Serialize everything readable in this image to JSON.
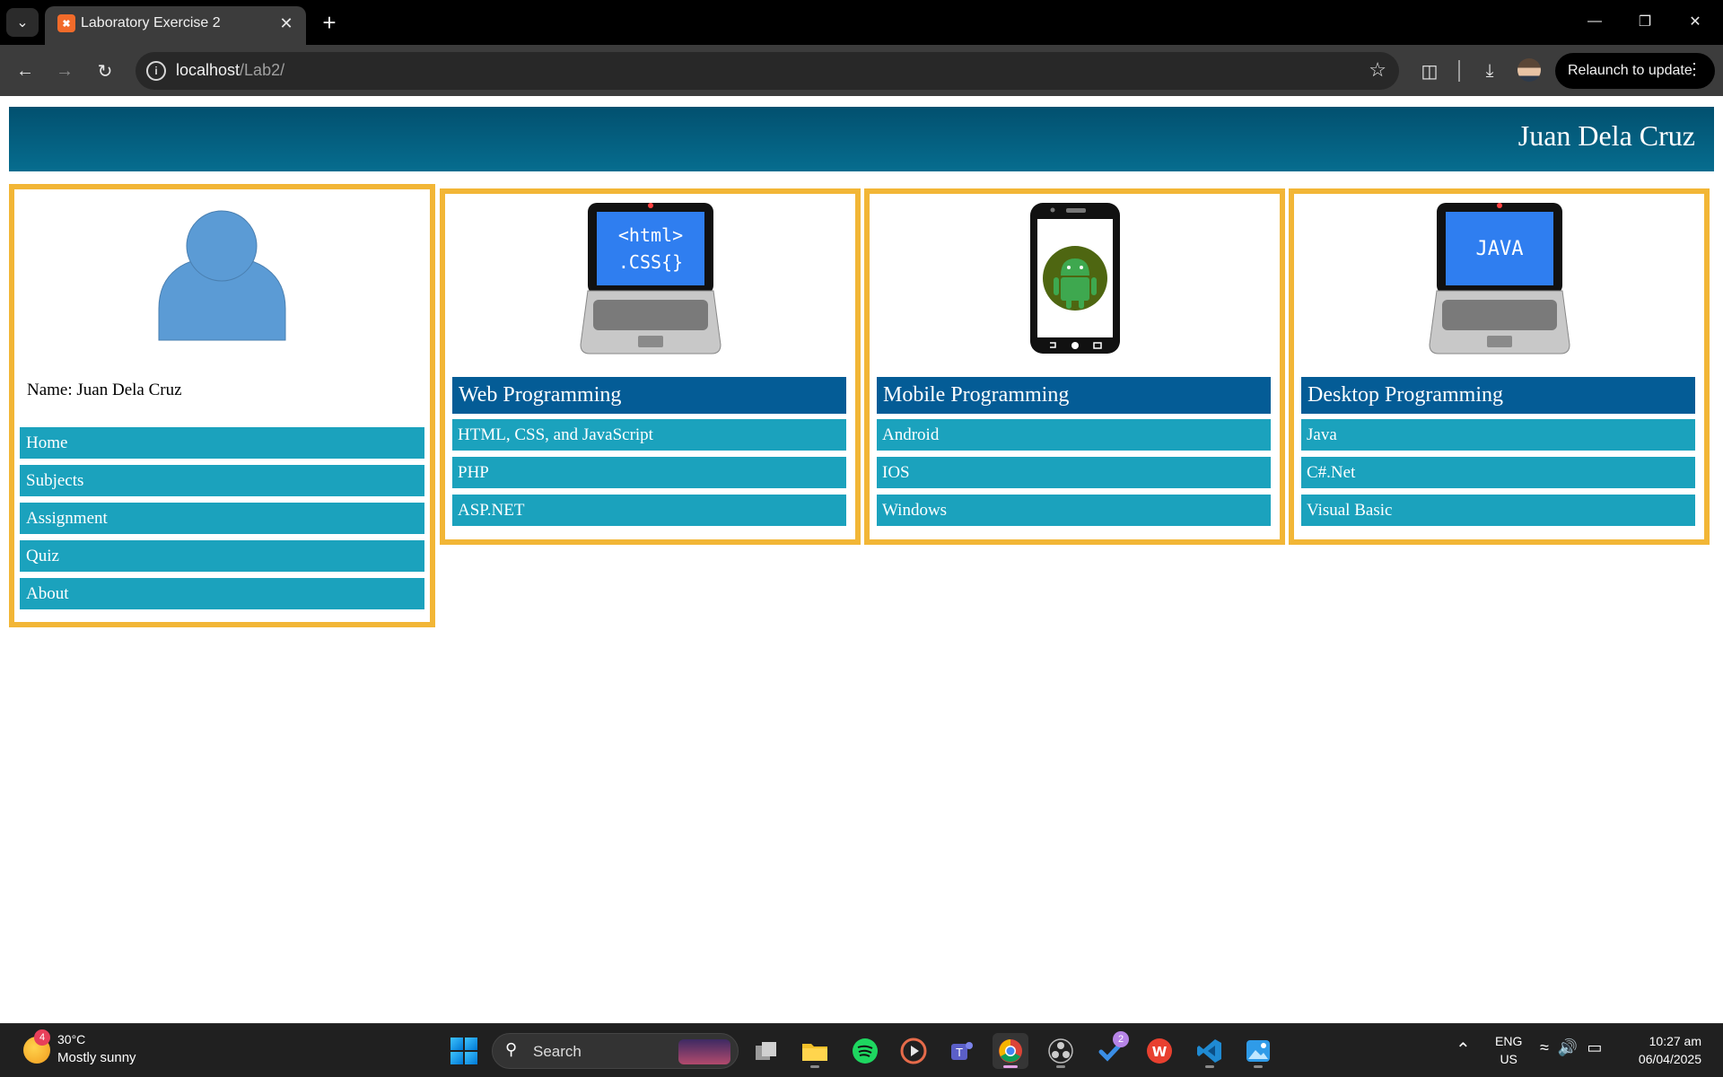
{
  "browser": {
    "tab_title": "Laboratory Exercise 2",
    "url_host": "localhost",
    "url_path": "/Lab2/",
    "relaunch_label": "Relaunch to update"
  },
  "page": {
    "header_name": "Juan Dela Cruz",
    "profile_name": "Name: Juan Dela Cruz",
    "nav": [
      {
        "label": "Home"
      },
      {
        "label": "Subjects"
      },
      {
        "label": "Assignment"
      },
      {
        "label": "Quiz"
      },
      {
        "label": "About"
      }
    ],
    "subjects": [
      {
        "title": "Web Programming",
        "items": [
          "HTML, CSS, and JavaScript",
          "PHP",
          "ASP.NET"
        ],
        "image_text": [
          "<html>",
          ".CSS{}"
        ]
      },
      {
        "title": "Mobile Programming",
        "items": [
          "Android",
          "IOS",
          "Windows"
        ]
      },
      {
        "title": "Desktop Programming",
        "items": [
          "Java",
          "C#.Net",
          "Visual Basic"
        ],
        "image_text": [
          "JAVA"
        ]
      }
    ],
    "colors": {
      "header": "#03597a",
      "border": "#f2b636",
      "subject_title": "#045c96",
      "nav_item": "#1ba2bd"
    }
  },
  "taskbar": {
    "weather_badge": "4",
    "weather_temp": "30°C",
    "weather_desc": "Mostly sunny",
    "search_label": "Search",
    "todo_badge": "2",
    "lang_top": "ENG",
    "lang_bottom": "US",
    "time": "10:27 am",
    "date": "06/04/2025"
  }
}
